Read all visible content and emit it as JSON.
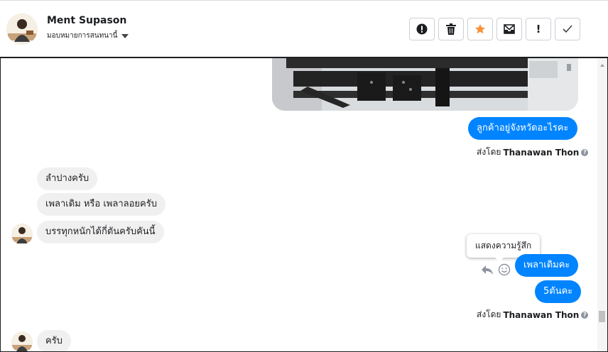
{
  "header": {
    "contact_name": "Ment Supason",
    "assign_label": "มอบหมายการสนทนานี้",
    "actions": {
      "spam": "!",
      "delete": "",
      "star": "",
      "mark_unread": "",
      "follow_up": "!",
      "done": ""
    }
  },
  "conversation": {
    "messages": {
      "m1": "ลูกค้าอยู่จังหวัดอะไรคะ",
      "m2": "ลำปางครับ",
      "m3": "เพลาเดิม หรือ เพลาลอยครับ",
      "m4": "บรรทุกหนักได้กี่ตันครับคันนี้",
      "m5": "เพลาเดิมคะ",
      "m6": "5ตันคะ",
      "m7": "ครับ"
    },
    "sent_by_prefix": "ส่งโดย",
    "sent_by_name": "Thanawan Thon",
    "reaction_tooltip": "แสดงความรู้สึก"
  },
  "colors": {
    "outgoing_bubble": "#0084ff",
    "incoming_bubble": "#f0f0f0",
    "star_accent": "#f7923a"
  }
}
